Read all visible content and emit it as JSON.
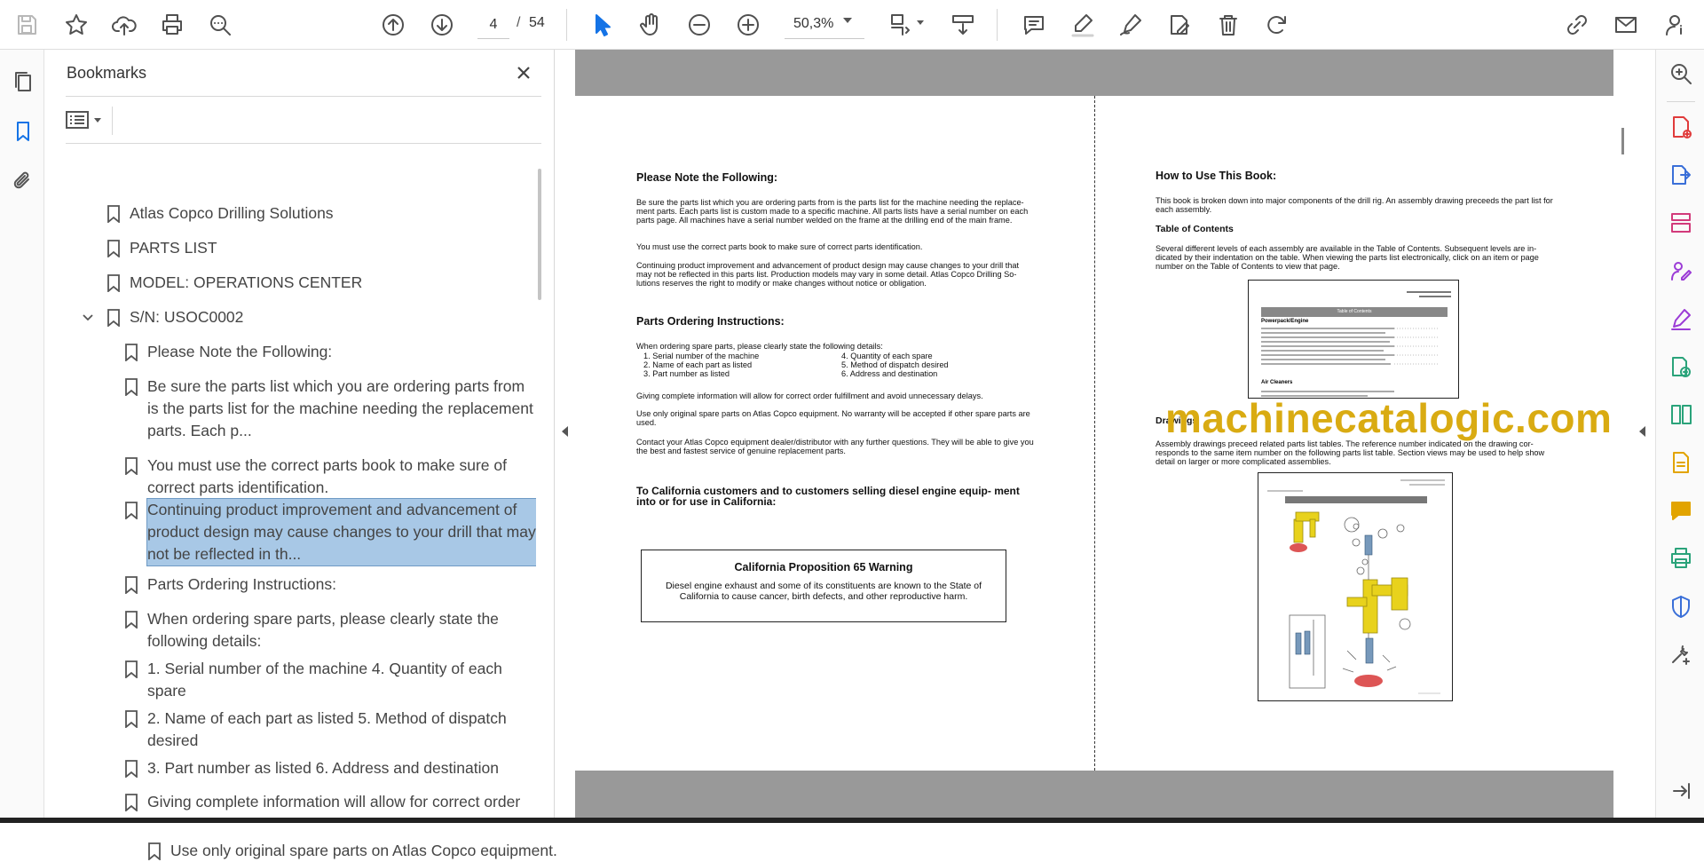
{
  "toolbar": {
    "page_current": "4",
    "page_slash": "/",
    "page_total": "54",
    "zoom": "50,3%"
  },
  "bookmarks": {
    "title": "Bookmarks",
    "items": [
      {
        "label": "Atlas Copco Drilling Solutions",
        "level": 0
      },
      {
        "label": "PARTS LIST",
        "level": 0
      },
      {
        "label": "MODEL: OPERATIONS CENTER",
        "level": 0
      },
      {
        "label": "S/N: USOC0002",
        "level": 0,
        "expanded": true
      },
      {
        "label": "Please Note the Following:",
        "level": 1
      },
      {
        "label": "Be sure the parts list which you are ordering parts from is the parts list for the machine needing the replacement parts. Each p...",
        "level": 1
      },
      {
        "label": "You must use the correct parts book to make sure of correct parts identification.",
        "level": 1
      },
      {
        "label": "Continuing product improvement and advancement of product design may cause changes to your drill that may not be reflected in th...",
        "level": 1,
        "selected": true
      },
      {
        "label": "Parts Ordering Instructions:",
        "level": 1
      },
      {
        "label": "When ordering spare parts, please clearly state the following details:",
        "level": 1
      },
      {
        "label": "1. Serial number of the machine 4. Quantity of each spare",
        "level": 1
      },
      {
        "label": "2. Name of each part as listed 5. Method of dispatch desired",
        "level": 1
      },
      {
        "label": "3. Part number as listed 6. Address and destination",
        "level": 1
      },
      {
        "label": "Giving complete information will allow for correct order fulfillment and avoid unnecessary delays.",
        "level": 1
      },
      {
        "label": "Use only original spare parts on Atlas Copco equipment.",
        "level": 1
      }
    ]
  },
  "document": {
    "left": {
      "h1": "Please Note the Following:",
      "p1": "Be sure the parts list which you are ordering parts from is the parts list for the machine needing the replace- ment parts.  Each parts list is custom made to a specific machine. All parts lists have a serial number on each parts page. All machines have a serial number welded on the frame at the drilling end of the main frame.",
      "p2": "You must use the correct parts book to make sure of correct parts identification.",
      "p3": "Continuing product improvement and advancement of product design may cause changes to your drill that may not be reflected in this parts list. Production models may vary in some detail. Atlas Copco Drilling So- lutions reserves the right to modify or make changes without notice or obligation.",
      "h2": "Parts Ordering Instructions:",
      "p4": "When ordering spare parts, please clearly state the following details:",
      "list_a": [
        "1.  Serial number of the machine",
        "2.  Name of each part as listed",
        "3.  Part number as listed"
      ],
      "list_b": [
        "4.  Quantity of each spare",
        "5.  Method of dispatch desired",
        "6.  Address and destination"
      ],
      "p5": "Giving complete information will allow for correct order fulfillment and avoid unnecessary delays.",
      "p6": "Use only original spare parts on Atlas Copco equipment. No warranty will be accepted if other spare parts are used.",
      "p7": "Contact your Atlas Copco equipment dealer/distributor with any further questions.  They will be able to give you the best and fastest service of genuine replacement parts.",
      "h3": "To California customers and to customers selling diesel engine equip- ment into or for use in California:",
      "warn_title": "California Proposition 65 Warning",
      "warn_text": "Diesel engine exhaust and some of its constituents are known to the State of California to cause cancer, birth defects, and other reproductive harm."
    },
    "right": {
      "h1": "How to Use This Book:",
      "p1": "This book is broken down into major components of the drill rig.  An assembly drawing preceeds the part list for each assembly.",
      "h2": "Table of Contents",
      "p2": "Several different levels of each assembly are available in the Table of Contents.  Subsequent levels are in- dicated by their indentation on the table.  When viewing the parts list electronically, click on an item or page number on the Table of Contents to view that page.",
      "h3": "Drawings",
      "p3": "Assembly drawings preceed related parts list tables.  The reference number indicated on the drawing cor- responds to the same item number on the following parts list table.  Section views may be used to help show detail on larger or more complicated assemblies.",
      "toc_header": "Table of Contents",
      "toc_section": "Powerpack/Engine",
      "toc_section2": "Air Cleaners"
    },
    "watermark": "machinecatalogic.com"
  },
  "colors": {
    "accent": "#1473e6",
    "selection": "#a8c8e6",
    "watermark": "#d9ab12"
  }
}
